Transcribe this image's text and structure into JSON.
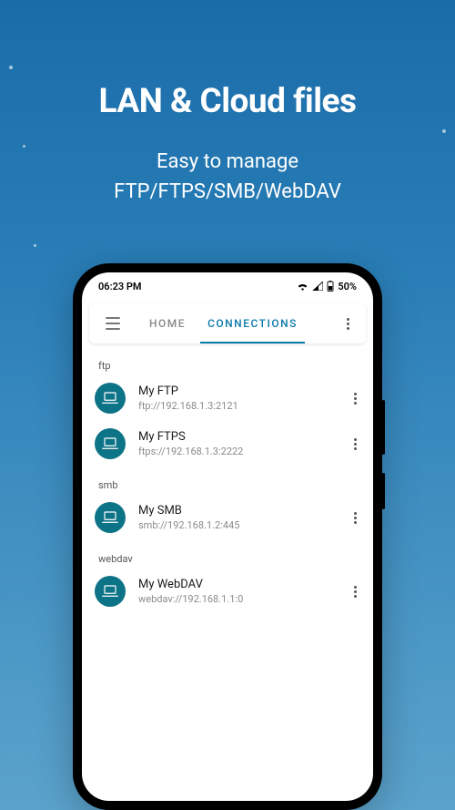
{
  "promo": {
    "title": "LAN & Cloud files",
    "subline1": "Easy to manage",
    "subline2": "FTP/FTPS/SMB/WebDAV"
  },
  "statusbar": {
    "time": "06:23 PM",
    "battery": "50%"
  },
  "toolbar": {
    "tabs": [
      {
        "label": "HOME",
        "active": false
      },
      {
        "label": "CONNECTIONS",
        "active": true
      }
    ]
  },
  "sections": [
    {
      "header": "ftp",
      "items": [
        {
          "title": "My FTP",
          "sub": "ftp://192.168.1.3:2121"
        },
        {
          "title": "My FTPS",
          "sub": "ftps://192.168.1.3:2222"
        }
      ]
    },
    {
      "header": "smb",
      "items": [
        {
          "title": "My SMB",
          "sub": "smb://192.168.1.2:445"
        }
      ]
    },
    {
      "header": "webdav",
      "items": [
        {
          "title": "My WebDAV",
          "sub": "webdav://192.168.1.1:0"
        }
      ]
    }
  ],
  "colors": {
    "accent": "#0a7aa8",
    "avatarBg": "#0d7387"
  }
}
